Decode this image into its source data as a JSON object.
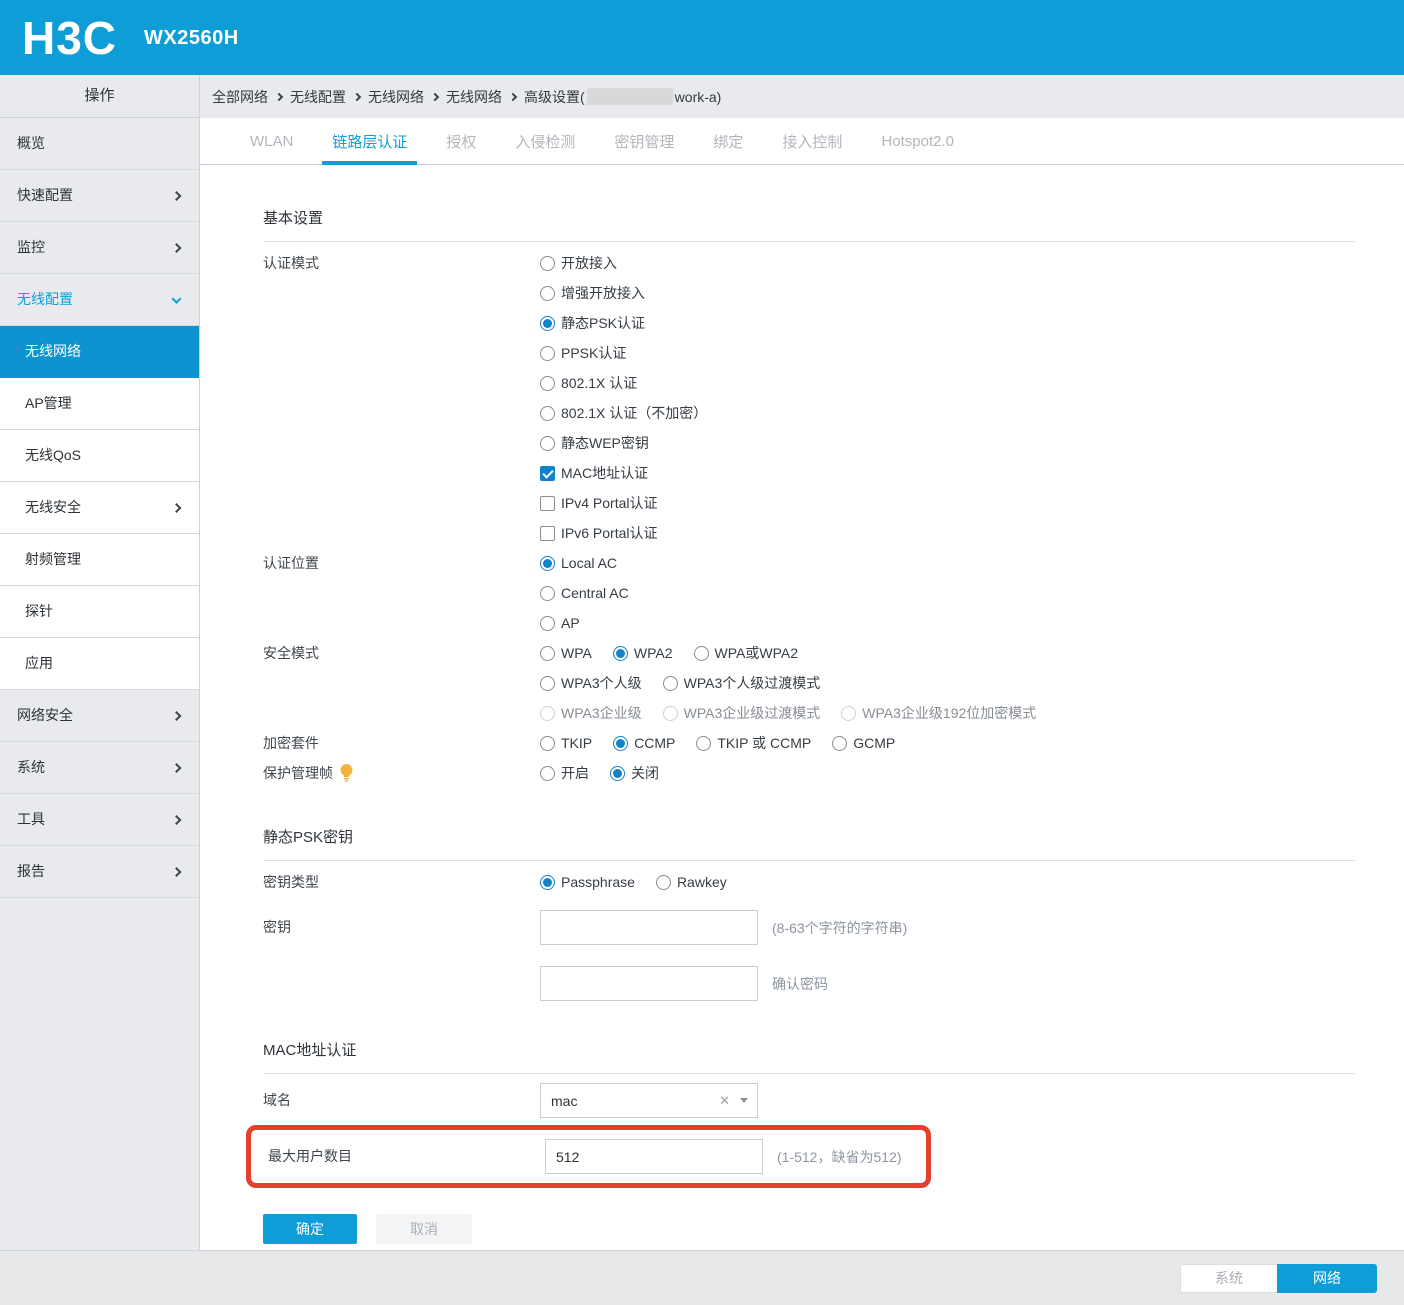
{
  "header": {
    "logo": "H3C",
    "model": "WX2560H"
  },
  "sidebar": {
    "title": "操作",
    "items": [
      {
        "label": "概览"
      },
      {
        "label": "快速配置"
      },
      {
        "label": "监控"
      },
      {
        "label": "无线配置"
      },
      {
        "label": "无线网络"
      },
      {
        "label": "AP管理"
      },
      {
        "label": "无线QoS"
      },
      {
        "label": "无线安全"
      },
      {
        "label": "射频管理"
      },
      {
        "label": "探针"
      },
      {
        "label": "应用"
      },
      {
        "label": "网络安全"
      },
      {
        "label": "系统"
      },
      {
        "label": "工具"
      },
      {
        "label": "报告"
      }
    ]
  },
  "breadcrumb": {
    "items": [
      "全部网络",
      "无线配置",
      "无线网络",
      "无线网络"
    ],
    "last_prefix": "高级设置(",
    "last_suffix": "work-a)"
  },
  "tabs": [
    {
      "label": "WLAN",
      "active": false
    },
    {
      "label": "链路层认证",
      "active": true
    },
    {
      "label": "授权",
      "active": false
    },
    {
      "label": "入侵检测",
      "active": false
    },
    {
      "label": "密钥管理",
      "active": false
    },
    {
      "label": "绑定",
      "active": false
    },
    {
      "label": "接入控制",
      "active": false
    },
    {
      "label": "Hotspot2.0",
      "active": false
    }
  ],
  "form": {
    "basic": {
      "title": "基本设置",
      "auth_mode_label": "认证模式",
      "auth_mode_options": [
        {
          "label": "开放接入",
          "type": "radio",
          "checked": false
        },
        {
          "label": "增强开放接入",
          "type": "radio",
          "checked": false
        },
        {
          "label": "静态PSK认证",
          "type": "radio",
          "checked": true
        },
        {
          "label": "PPSK认证",
          "type": "radio",
          "checked": false
        },
        {
          "label": "802.1X 认证",
          "type": "radio",
          "checked": false
        },
        {
          "label": "802.1X 认证（不加密）",
          "type": "radio",
          "checked": false
        },
        {
          "label": "静态WEP密钥",
          "type": "radio",
          "checked": false
        },
        {
          "label": "MAC地址认证",
          "type": "checkbox",
          "checked": true
        },
        {
          "label": "IPv4 Portal认证",
          "type": "checkbox",
          "checked": false
        },
        {
          "label": "IPv6 Portal认证",
          "type": "checkbox",
          "checked": false
        }
      ],
      "auth_location_label": "认证位置",
      "auth_location_options": [
        {
          "label": "Local AC",
          "checked": true
        },
        {
          "label": "Central AC",
          "checked": false
        },
        {
          "label": "AP",
          "checked": false
        }
      ],
      "security_mode_label": "安全模式",
      "security_row1": [
        {
          "label": "WPA",
          "checked": false
        },
        {
          "label": "WPA2",
          "checked": true
        },
        {
          "label": "WPA或WPA2",
          "checked": false
        }
      ],
      "security_row2": [
        {
          "label": "WPA3个人级",
          "checked": false
        },
        {
          "label": "WPA3个人级过渡模式",
          "checked": false
        }
      ],
      "security_row3": [
        {
          "label": "WPA3企业级",
          "checked": false,
          "disabled": true
        },
        {
          "label": "WPA3企业级过渡模式",
          "checked": false,
          "disabled": true
        },
        {
          "label": "WPA3企业级192位加密模式",
          "checked": false,
          "disabled": true
        }
      ],
      "cipher_label": "加密套件",
      "cipher_options": [
        {
          "label": "TKIP",
          "checked": false
        },
        {
          "label": "CCMP",
          "checked": true
        },
        {
          "label": "TKIP 或 CCMP",
          "checked": false
        },
        {
          "label": "GCMP",
          "checked": false
        }
      ],
      "pmf_label": "保护管理帧",
      "pmf_options": [
        {
          "label": "开启",
          "checked": false
        },
        {
          "label": "关闭",
          "checked": true
        }
      ]
    },
    "psk": {
      "title": "静态PSK密钥",
      "key_type_label": "密钥类型",
      "key_type_options": [
        {
          "label": "Passphrase",
          "checked": true
        },
        {
          "label": "Rawkey",
          "checked": false
        }
      ],
      "key_label": "密钥",
      "key_value": "",
      "key_hint": "(8-63个字符的字符串)",
      "confirm_value": "",
      "confirm_hint": "确认密码"
    },
    "mac": {
      "title": "MAC地址认证",
      "domain_label": "域名",
      "domain_value": "mac",
      "max_users_label": "最大用户数目",
      "max_users_value": "512",
      "max_users_hint": "(1-512，缺省为512)"
    },
    "buttons": {
      "ok": "确定",
      "cancel": "取消"
    }
  },
  "footer": {
    "system": "系统",
    "network": "网络"
  },
  "colors": {
    "brand_blue": "#0f9dd7",
    "active_nav": "#0d93d0",
    "annotation_red": "#e73f2e",
    "bulb_yellow": "#f3b43c"
  }
}
